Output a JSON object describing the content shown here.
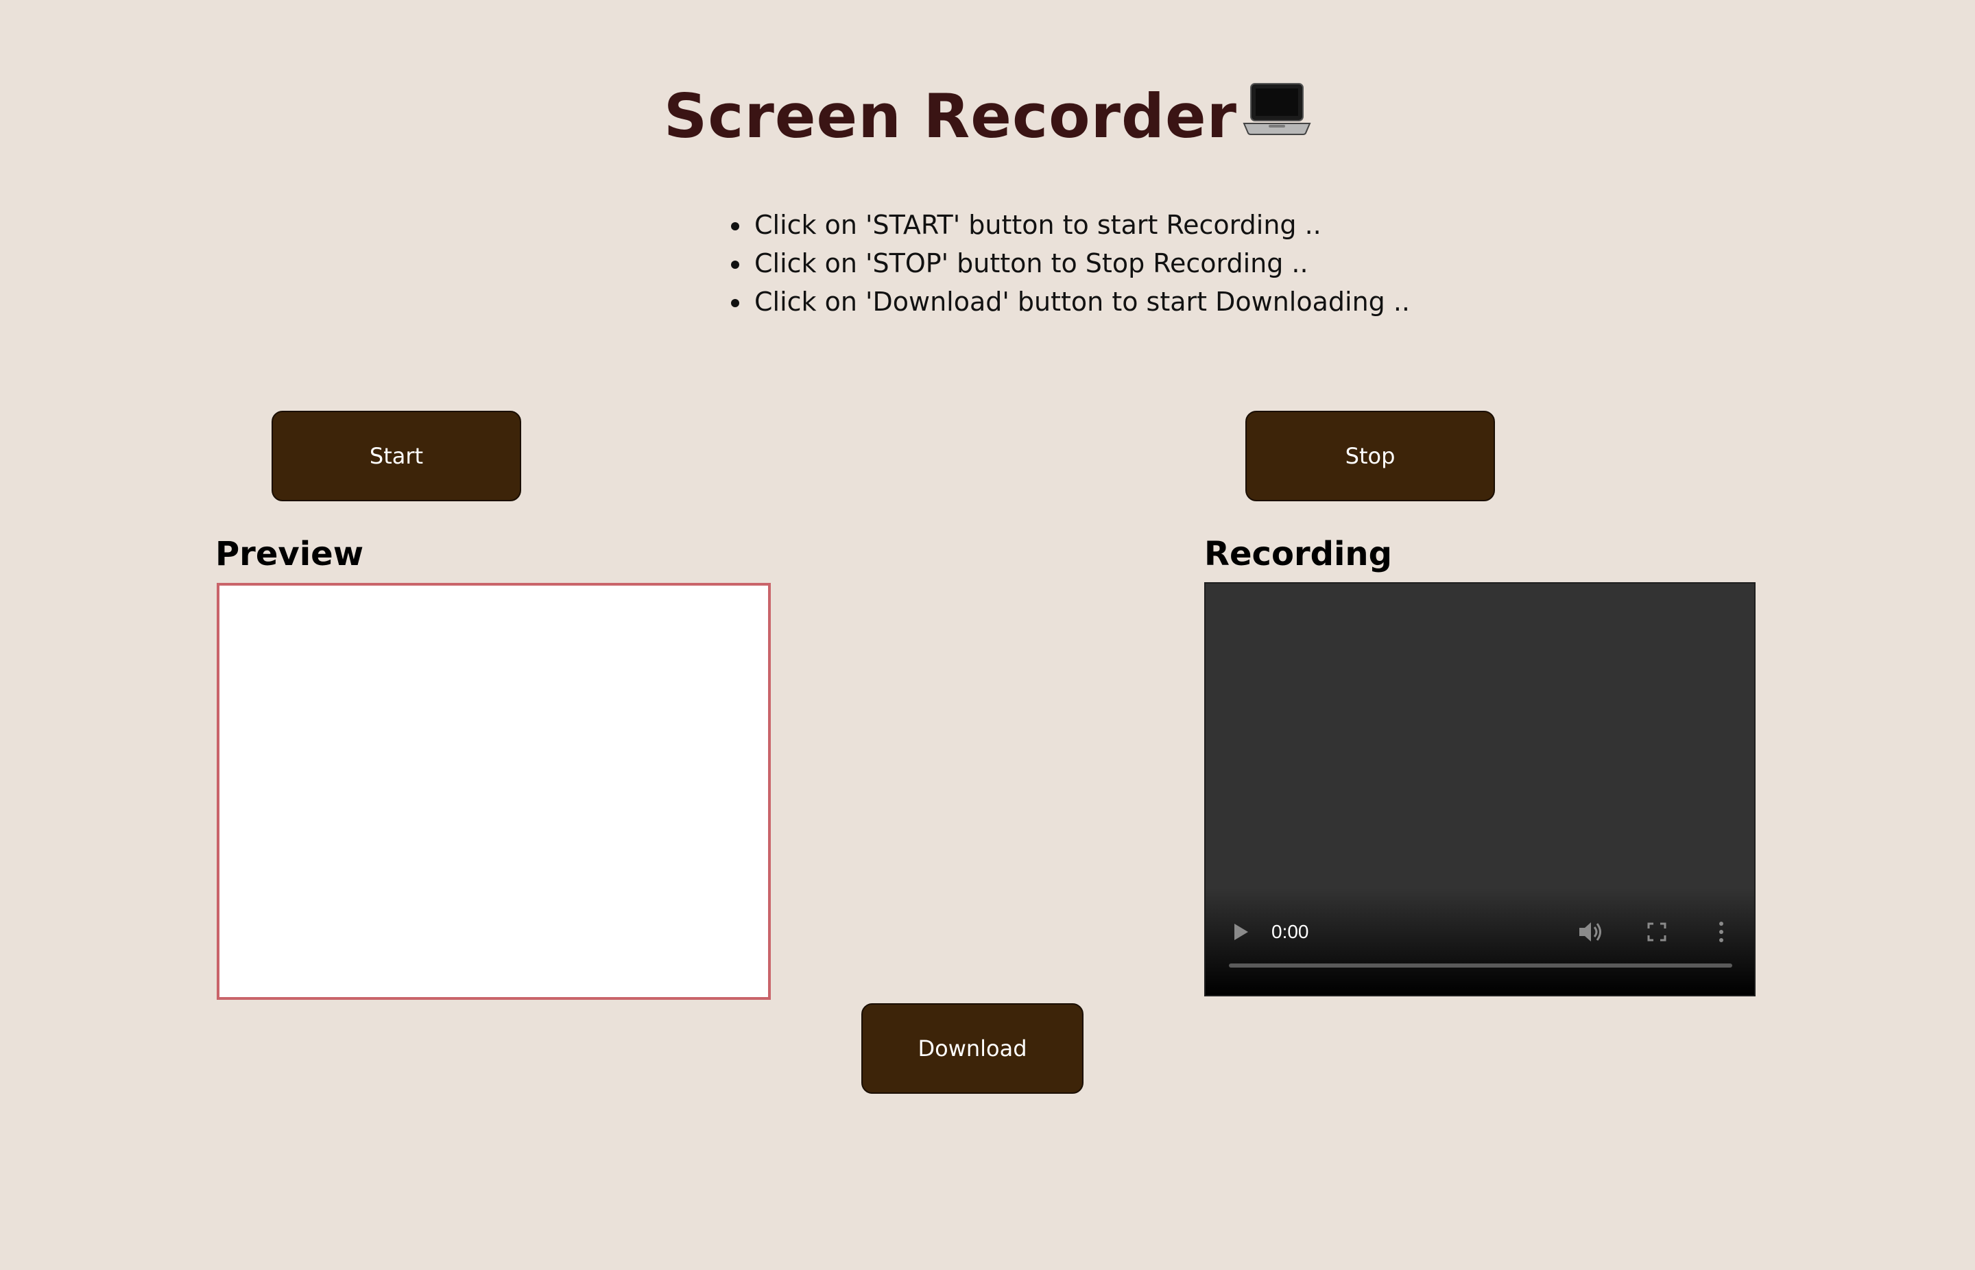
{
  "header": {
    "title": "Screen Recorder",
    "title_emoji_icon": "laptop-icon"
  },
  "instructions": [
    "Click on 'START' button to start Recording ..",
    "Click on 'STOP' button to Stop Recording ..",
    "Click on 'Download' button to start Downloading .."
  ],
  "controls": {
    "start_label": "Start",
    "stop_label": "Stop",
    "download_label": "Download"
  },
  "panels": {
    "preview_label": "Preview",
    "recording_label": "Recording"
  },
  "player": {
    "current_time": "0:00",
    "progress": 0,
    "icons": [
      "play-icon",
      "volume-icon",
      "fullscreen-icon",
      "more-options-icon"
    ]
  },
  "colors": {
    "background": "#eae1d9",
    "title": "#3a1414",
    "button": "#3d2409",
    "preview_border": "#c9646a"
  }
}
